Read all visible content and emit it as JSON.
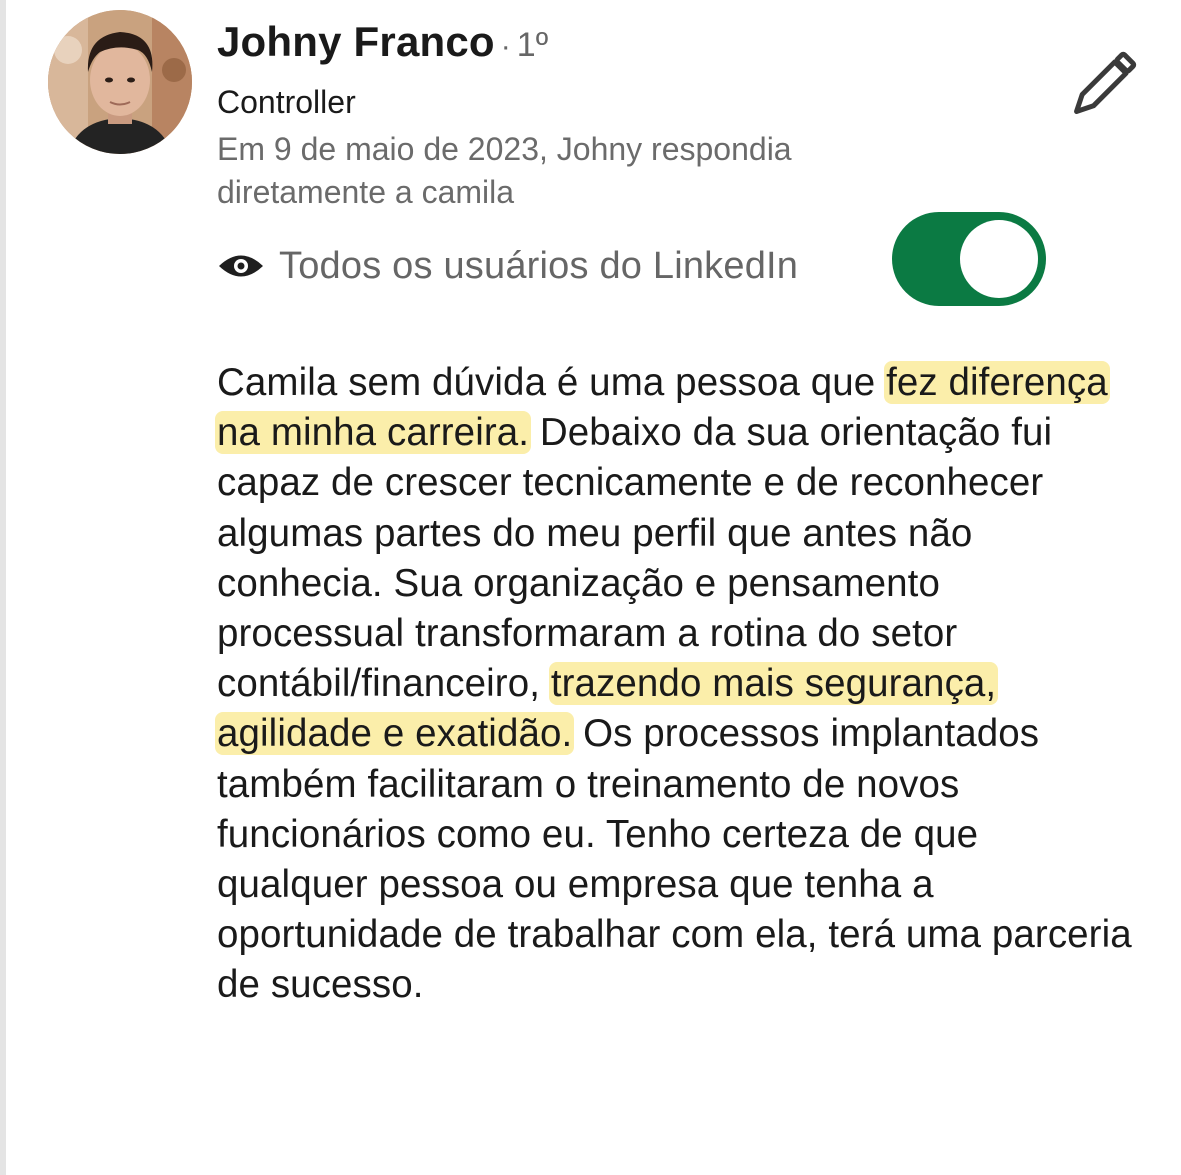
{
  "author": {
    "name": "Johny Franco",
    "degree_separator": "·",
    "degree": "1º",
    "headline": "Controller",
    "relationship": "Em 9 de maio de 2023, Johny respondia diretamente a camila"
  },
  "visibility": {
    "label": "Todos os usuários do LinkedIn",
    "toggle_on": true,
    "toggle_color": "#0b7a43"
  },
  "icons": {
    "edit": "pencil-icon",
    "visibility": "eye-icon"
  },
  "recommendation": {
    "highlight_color": "#fbeeaa",
    "segments": [
      {
        "text": "Camila sem dúvida é uma pessoa que ",
        "highlight": false
      },
      {
        "text": "fez diferença na minha carreira.",
        "highlight": true
      },
      {
        "text": " Debaixo da sua orientação fui capaz de crescer tecnicamente e de reconhecer algumas partes do meu perfil que antes não conhecia. Sua organização e pensamento processual transformaram a rotina do setor contábil/financeiro, ",
        "highlight": false
      },
      {
        "text": "trazendo mais segurança, agilidade e exatidão.",
        "highlight": true
      },
      {
        "text": " Os processos implantados também facilitaram o treinamento de novos funcionários como eu. Tenho certeza de que qualquer pessoa ou empresa que tenha a oportunidade de trabalhar com ela, terá uma parceria de sucesso.",
        "highlight": false
      }
    ]
  }
}
